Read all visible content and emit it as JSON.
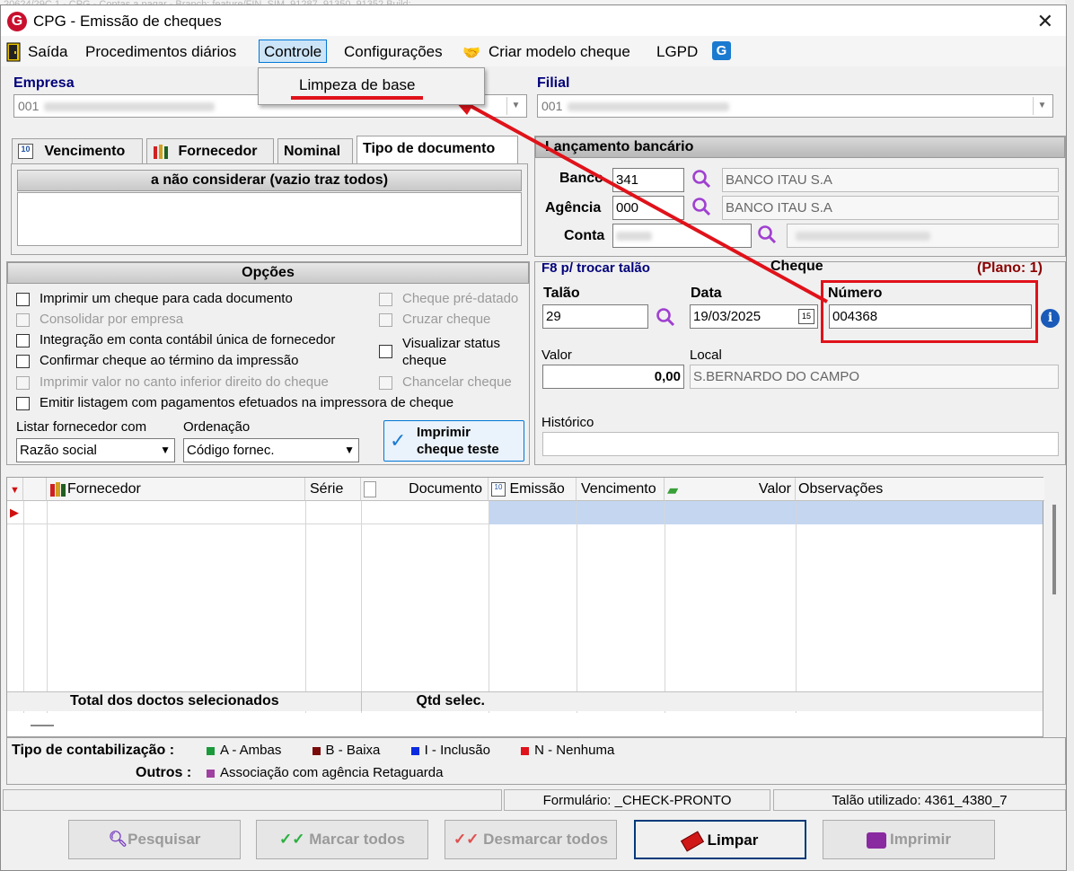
{
  "window": {
    "title": "CPG - Emissão de cheques",
    "background_title_text": "20624/29C.1 - CPG - Contas a pagar - Branch: feature/FIN_SIM_91287_91350_91352 Build:"
  },
  "menu": {
    "items": [
      {
        "label": "Saída",
        "icon": "exit-door-icon"
      },
      {
        "label": "Procedimentos diários"
      },
      {
        "label": "Controle",
        "active": true
      },
      {
        "label": "Configurações"
      },
      {
        "label": "Criar modelo cheque",
        "icon": "handshake-icon"
      },
      {
        "label": "LGPD"
      }
    ],
    "dropdown_item": "Limpeza de base"
  },
  "empresa": {
    "label": "Empresa",
    "value": "001"
  },
  "filial": {
    "label": "Filial",
    "value": "001"
  },
  "tabs": [
    "Vencimento",
    "Fornecedor",
    "Nominal",
    "Tipo de documento"
  ],
  "tipo_doc_header": "a não considerar (vazio traz todos)",
  "lancamento": {
    "title": "Lançamento bancário",
    "banco_label": "Banco",
    "banco_code": "341",
    "banco_name": "BANCO ITAU S.A",
    "agencia_label": "Agência",
    "agencia_code": "000",
    "agencia_name": "BANCO ITAU S.A",
    "conta_label": "Conta"
  },
  "opcoes": {
    "title": "Opções",
    "left": [
      {
        "label": "Imprimir um cheque para cada documento",
        "enabled": true
      },
      {
        "label": "Consolidar por empresa",
        "enabled": false
      },
      {
        "label": "Integração em conta contábil única de fornecedor",
        "enabled": true
      },
      {
        "label": "Confirmar cheque ao término da impressão",
        "enabled": true
      },
      {
        "label": "Imprimir valor no canto inferior direito do cheque",
        "enabled": false
      },
      {
        "label": "Emitir listagem com pagamentos efetuados na impressora de cheque",
        "enabled": true
      }
    ],
    "right": [
      {
        "label": "Cheque pré-datado",
        "enabled": false
      },
      {
        "label": "Cruzar cheque",
        "enabled": false
      },
      {
        "label": "Visualizar status",
        "label2": "cheque",
        "enabled": true
      },
      {
        "label": "Chancelar cheque",
        "enabled": false
      }
    ],
    "listar_label": "Listar fornecedor com",
    "listar_value": "Razão social",
    "ordenacao_label": "Ordenação",
    "ordenacao_value": "Código fornec.",
    "imprimir_teste_line1": "Imprimir",
    "imprimir_teste_line2": "cheque teste"
  },
  "cheque": {
    "f8_hint": "F8 p/ trocar talão",
    "title": "Cheque",
    "plano": "(Plano: 1)",
    "talao_label": "Talão",
    "talao_value": "29",
    "data_label": "Data",
    "data_value": "19/03/2025",
    "numero_label": "Número",
    "numero_value": "004368",
    "valor_label": "Valor",
    "valor_value": "0,00",
    "local_label": "Local",
    "local_value": "S.BERNARDO DO CAMPO",
    "historico_label": "Histórico",
    "historico_value": ""
  },
  "grid": {
    "columns": [
      "Fornecedor",
      "Série",
      "Documento",
      "Emissão",
      "Vencimento",
      "Valor",
      "Observações"
    ],
    "footer_total": "Total dos doctos selecionados",
    "footer_qtd": "Qtd selec."
  },
  "legend": {
    "tipo_label": "Tipo de contabilização :",
    "items": [
      {
        "label": "A - Ambas",
        "color": "#1a9a3a"
      },
      {
        "label": "B - Baixa",
        "color": "#7a0a0a"
      },
      {
        "label": "I - Inclusão",
        "color": "#0a2ae0"
      },
      {
        "label": "N - Nenhuma",
        "color": "#e0121a"
      }
    ],
    "outros_label": "Outros :",
    "outros_item": {
      "label": "Associação com agência Retaguarda",
      "color": "#a040a0"
    }
  },
  "status": {
    "formulario": "Formulário: _CHECK-PRONTO",
    "talao": "Talão utilizado: 4361_4380_7"
  },
  "buttons": {
    "pesquisar": "Pesquisar",
    "marcar": "Marcar todos",
    "desmarcar": "Desmarcar todos",
    "limpar": "Limpar",
    "imprimir": "Imprimir"
  },
  "colors": {
    "accent_red": "#e0121a",
    "label_blue": "#00007a",
    "dark_red": "#8b0000",
    "selection": "#c4d6f0"
  }
}
